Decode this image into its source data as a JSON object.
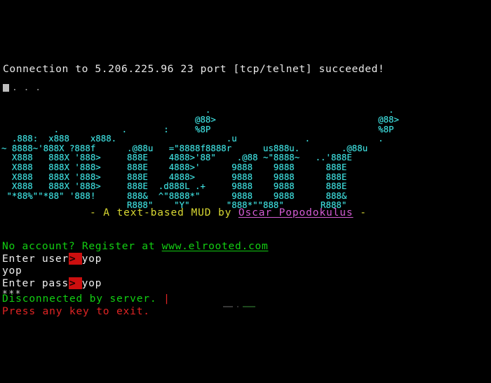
{
  "terminal": {
    "background_color": "#000000",
    "connection_line": "Connection to 5.206.225.96 23 port [tcp/telnet] succeeded!",
    "dots_line": ". . .",
    "cursor_glyph": "block-cursor"
  },
  "colors": {
    "cyan_art": "#3fe0e0",
    "green_text": "#12cf12",
    "yellow_tagline": "#d8d832",
    "magenta_author": "#d45cd4",
    "red_alert": "#e02424",
    "red_prompt_block": "#cc0f0f",
    "white_text": "#efefef"
  },
  "ascii_art": {
    "color": "#3fe0e0",
    "lines": [
      "                                       .                                  .",
      "                                     @88>                               @88>",
      "          .            .       :     %8P                                %8P",
      "  .888:  x888    x888.                     .u             .             .",
      "~ 8888~'888X ?888f      .@88u   =\"8888f8888r      us888u.        .@88u",
      "  X888   888X '888>     888E    4888>'88\"    .@88 ~\"8888~   ..'888E",
      "  X888   888X '888>     888E    4888>'      9888    9888      888E",
      "  X888   888X '888>     888E    4888>       9888    9888      888E",
      "  X888   888X '888>     888E  .d888L .+     9888    9888      888E",
      " \"*88%\"\"*88\" '888!      888&  ^\"8888*\"      9888    9888      888&",
      "                        R888\"    \"Y\"       \"888*\"\"888\"       R888\""
    ]
  },
  "tagline": {
    "prefix": "- A text-based MUD by ",
    "author": "Oscar Popodokulus",
    "suffix": " -"
  },
  "login": {
    "register_prompt": "No account? Register at ",
    "register_url": "www.elrooted.com",
    "user_label": "Enter user",
    "user_prompt_caret": ">",
    "user_value": "yop",
    "echo_line": "yop",
    "pass_label": "Enter pass",
    "pass_prompt_caret": ">",
    "pass_value": "yop",
    "masked_line": "***"
  },
  "disconnect": {
    "message": "Disconnected by server.",
    "cursor": "|",
    "exit_prompt": "Press any key to exit."
  }
}
